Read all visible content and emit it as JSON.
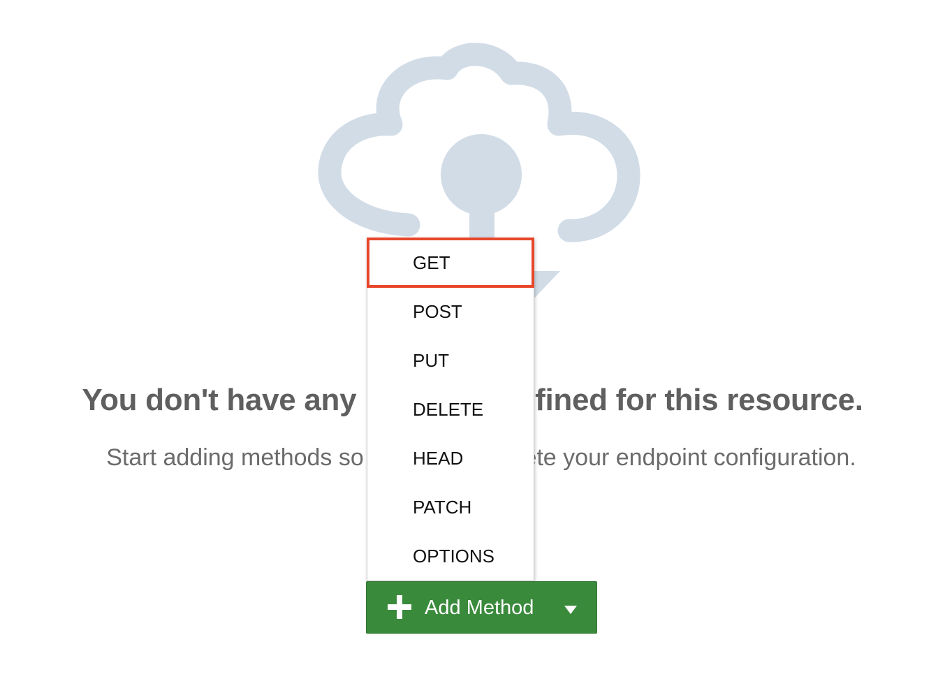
{
  "empty_state": {
    "title": "You don't have any methods defined for this resource.",
    "subtitle": "Start adding methods so you can complete your endpoint configuration."
  },
  "method_menu": {
    "items": [
      {
        "label": "GET",
        "highlighted": true
      },
      {
        "label": "POST"
      },
      {
        "label": "PUT"
      },
      {
        "label": "DELETE"
      },
      {
        "label": "HEAD"
      },
      {
        "label": "PATCH"
      },
      {
        "label": "OPTIONS"
      }
    ]
  },
  "add_method_button": {
    "label": "Add Method",
    "icon": "plus-icon",
    "dropdown_icon": "caret-down-icon",
    "color": "#3a8a3c"
  },
  "colors": {
    "illustration": "#d1dce7",
    "highlight": "#e8472b"
  }
}
